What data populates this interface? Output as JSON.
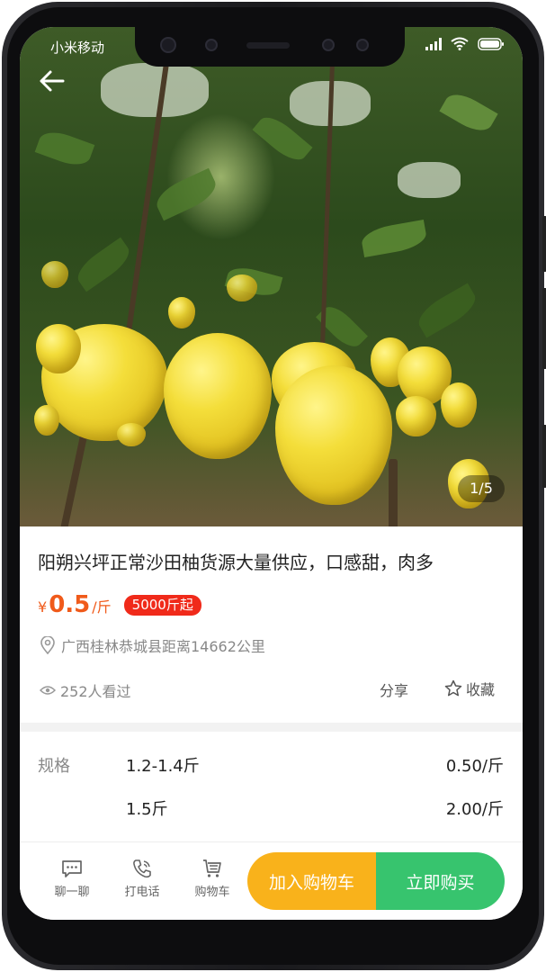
{
  "status_bar": {
    "carrier": "小米移动"
  },
  "gallery": {
    "counter": "1/5"
  },
  "product": {
    "title": "阳朔兴坪正常沙田柚货源大量供应，口感甜，肉多",
    "currency": "¥",
    "price": "0.5",
    "unit": "/斤",
    "moq": "5000斤起",
    "location": "广西桂林恭城县距离14662公里",
    "views": "252人看过",
    "share": "分享",
    "favorite": "收藏"
  },
  "specs": {
    "label": "规格",
    "rows": [
      {
        "value": "1.2-1.4斤",
        "price": "0.50/斤"
      },
      {
        "value": "1.5斤",
        "price": "2.00/斤"
      }
    ]
  },
  "bottom_bar": {
    "chat": "聊一聊",
    "call": "打电话",
    "cart": "购物车",
    "add_to_cart": "加入购物车",
    "buy_now": "立即购买"
  },
  "colors": {
    "accent_price": "#f05a1a",
    "badge": "#f02a1a",
    "cart_button": "#f9b21b",
    "buy_button": "#37c46e"
  },
  "icons": [
    "back-arrow-icon",
    "signal-icon",
    "wifi-icon",
    "battery-icon",
    "location-pin-icon",
    "eye-icon",
    "star-icon",
    "chat-icon",
    "phone-icon",
    "cart-icon"
  ]
}
